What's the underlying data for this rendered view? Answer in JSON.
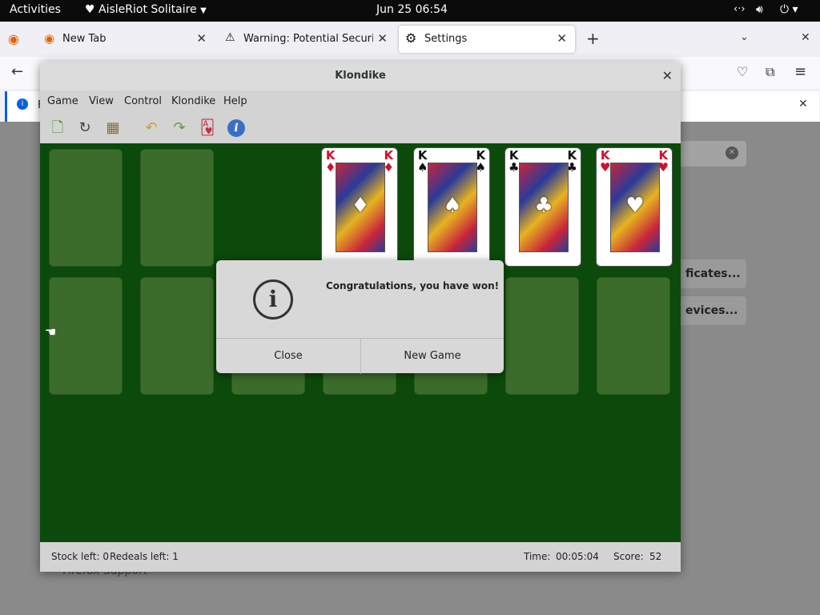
{
  "topbar": {
    "activities": "Activities",
    "app_name": "AisleRiot Solitaire",
    "datetime": "Jun 25  06:54"
  },
  "firefox": {
    "tabs": [
      {
        "label": "New Tab"
      },
      {
        "label": "Warning: Potential Security R"
      },
      {
        "label": "Settings"
      }
    ],
    "notification_letter": "F"
  },
  "window": {
    "title": "Klondike",
    "menu": [
      "Game",
      "View",
      "Control",
      "Klondike",
      "Help"
    ]
  },
  "foundations": [
    {
      "rank": "K",
      "suit": "♦",
      "color": "#d0102a"
    },
    {
      "rank": "K",
      "suit": "♠",
      "color": "#111111"
    },
    {
      "rank": "K",
      "suit": "♣",
      "color": "#111111"
    },
    {
      "rank": "K",
      "suit": "♥",
      "color": "#d0102a"
    }
  ],
  "dialog": {
    "message": "Congratulations, you have won!",
    "close_label": "Close",
    "new_game_label": "New Game"
  },
  "status": {
    "stock": "Stock left: 0",
    "redeals": "Redeals left: 1",
    "time_label": "Time:",
    "time_value": "00:05:04",
    "score_label": "Score:",
    "score_value": "52"
  },
  "background_text": {
    "certificates": "ficates...",
    "devices": "evices...",
    "support": "Firefox Support"
  }
}
